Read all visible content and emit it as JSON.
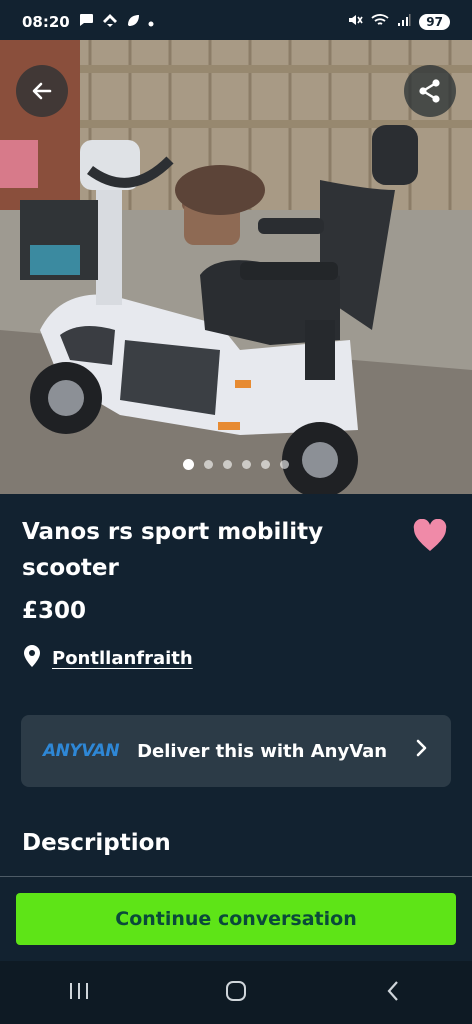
{
  "status": {
    "time": "08:20",
    "battery": "97",
    "icons": [
      "chat-icon",
      "feedly-icon",
      "leaf-icon",
      "dot-icon",
      "mute-icon",
      "wifi-icon",
      "signal-icon"
    ]
  },
  "gallery": {
    "image_count": 6,
    "active_index": 0
  },
  "listing": {
    "title": "Vanos rs sport mobility scooter",
    "price": "£300",
    "location": "Pontllanfraith"
  },
  "delivery": {
    "brand": "ANYVAN",
    "text": "Deliver this with AnyVan"
  },
  "description_heading": "Description",
  "cta": {
    "label": "Continue conversation"
  },
  "colors": {
    "background": "#122230",
    "cta": "#5ee417",
    "cta_text": "#0a4a3a",
    "favourite": "#f08aa8",
    "anyvan": "#2e87d6"
  }
}
